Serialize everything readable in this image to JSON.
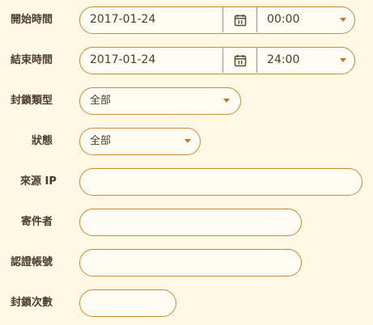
{
  "start_time": {
    "label": "開始時間",
    "date": "2017-01-24",
    "time": "00:00"
  },
  "end_time": {
    "label": "結束時間",
    "date": "2017-01-24",
    "time": "24:00"
  },
  "block_type": {
    "label": "封鎖類型",
    "value": "全部"
  },
  "status": {
    "label": "狀態",
    "value": "全部"
  },
  "source_ip": {
    "label": "來源 IP",
    "value": ""
  },
  "sender": {
    "label": "寄件者",
    "value": ""
  },
  "auth_account": {
    "label": "認證帳號",
    "value": ""
  },
  "block_count": {
    "label": "封鎖次數",
    "value": ""
  },
  "colors": {
    "background": "#fef8e5",
    "border": "#c88b2e",
    "caret": "#c0781c",
    "text": "#4a3b2a"
  },
  "icons": {
    "calendar": "calendar-icon",
    "dropdown": "chevron-down-icon"
  }
}
